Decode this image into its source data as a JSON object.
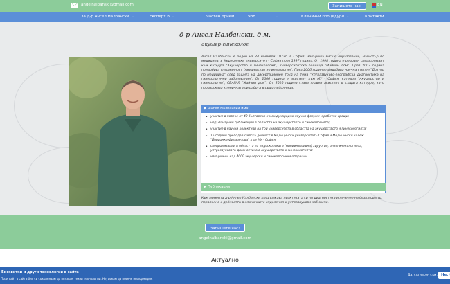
{
  "topbar": {
    "email": "angelnalbanski@gmail.com",
    "book_button": "Запишете час!",
    "language": "EN"
  },
  "nav": {
    "items": [
      {
        "label": "За д-р Ангел Налбански",
        "has_dropdown": true
      },
      {
        "label": "Експерт В",
        "has_dropdown": true
      },
      {
        "label": "Частен прием",
        "has_dropdown": false
      },
      {
        "label": "ЧЗВ",
        "has_dropdown": true
      },
      {
        "label": "Клинични процедури",
        "has_dropdown": true
      },
      {
        "label": "Контакти",
        "has_dropdown": false
      }
    ]
  },
  "profile": {
    "name": "д-р Ангел Налбански, д.м.",
    "role": "акушер-гинеколог",
    "bio": "Ангел Налбански е роден на 24 ноември 1972г. в София. Завършва висше образование, магистър по медицина, в Медицински университет - София през 1997 година. От 1998 година е редовен специализант към катедра \"Акушерство и гинекология\", Университетска болница \"Майчин дом\". През 2003 година придобива специалност \"Акушерство и гинекология\". През 2006 година придобива научна степен \"Доктор по медицина\" след защита на дисертационен труд на тема \"Ултразвуково-ехографска диагностика на гинекологични заболявания\". От 2006 година е асистент към МУ - София, катедра \"Акушерство и гинекология\", СБАГАЛ \"Майчин дом\". От 2010 година става главен асистент в същата катедра, като продължава клиничната си работа в същата болница."
  },
  "panel": {
    "title": "Ангел Налбански има:",
    "items": [
      "участие в повече от 40 български и международни научни форуми и работни срещи;",
      "над 30 научни публикации в областта на акушерството и гинекологията;",
      "участие в научни колективи на три университета в областта на акушерството и гинекологията;",
      "15 години преподавателска дейност в Медицински университет - София и Медицински колеж \"Йорданка Филаретова\" към МУ - София;",
      "специализации в областта на ендоскопската (миниинвазивна) хирургия, онкогинекологията, ултразвуковата диагностика в акушерството и гинекологията;",
      "извършени над 4000 акушерски и гинекологични операции."
    ],
    "publications_label": "Публикации"
  },
  "note": "Към момента д-р Ангел Налбански продължава практиката си по диагностика и лечение на безплодието, паралелно с дейността в клиничните отделения и ултразвукови кабинети.",
  "cta": {
    "button": "Запишете час!",
    "email": "angelnalbanski@gmail.com"
  },
  "news": {
    "heading": "Актуално"
  },
  "cookie": {
    "title": "Бисквитки и други технологии в сайта",
    "text": "Този сайт в сайта бих си съхранявам да ползвам техни технологии.",
    "link": "Не, искам да повече информация.",
    "agree_text": "Да, съгласен съм.",
    "agree_button": "Не, б"
  }
}
